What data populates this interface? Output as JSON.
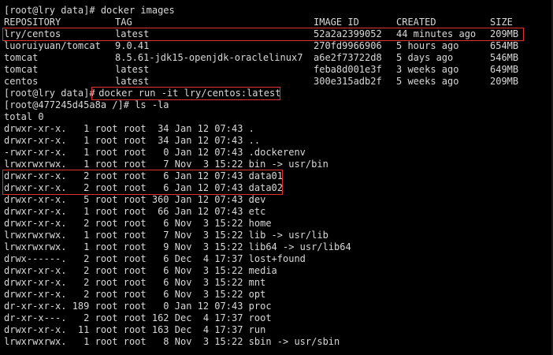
{
  "terminal": {
    "prompt_images": "[root@lry data]# docker images",
    "headers": {
      "repository": "REPOSITORY",
      "tag": "TAG",
      "image_id": "IMAGE ID",
      "created": "CREATED",
      "size": "SIZE"
    },
    "images": [
      {
        "repository": "lry/centos",
        "tag": "latest",
        "image_id": "52a2a2399052",
        "created": "44 minutes ago",
        "size": "209MB"
      },
      {
        "repository": "luoruiyuan/tomcat",
        "tag": "9.0.41",
        "image_id": "270fd9966906",
        "created": "5 hours ago",
        "size": "654MB"
      },
      {
        "repository": "tomcat",
        "tag": "8.5.61-jdk15-openjdk-oraclelinux7",
        "image_id": "a6e2f73722d8",
        "created": "5 days ago",
        "size": "546MB"
      },
      {
        "repository": "tomcat",
        "tag": "latest",
        "image_id": "feba8d001e3f",
        "created": "3 weeks ago",
        "size": "649MB"
      },
      {
        "repository": "centos",
        "tag": "latest",
        "image_id": "300e315adb2f",
        "created": "5 weeks ago",
        "size": "209MB"
      }
    ],
    "run_prompt": "[root@lry data]#",
    "run_command": " docker run -it lry/centos:latest",
    "ls_prompt": "[root@477245d45a8a /]# ls -la",
    "total": "total 0",
    "ls_lines": [
      "drwxr-xr-x.   1 root root  34 Jan 12 07:43 .",
      "drwxr-xr-x.   1 root root  34 Jan 12 07:43 ..",
      "-rwxr-xr-x.   1 root root   0 Jan 12 07:43 .dockerenv",
      "lrwxrwxrwx.   1 root root   7 Nov  3 15:22 bin -> usr/bin",
      "drwxr-xr-x.   2 root root   6 Jan 12 07:43 data01",
      "drwxr-xr-x.   2 root root   6 Jan 12 07:43 data02",
      "drwxr-xr-x.   5 root root 360 Jan 12 07:43 dev",
      "drwxr-xr-x.   1 root root  66 Jan 12 07:43 etc",
      "drwxr-xr-x.   2 root root   6 Nov  3 15:22 home",
      "lrwxrwxrwx.   1 root root   7 Nov  3 15:22 lib -> usr/lib",
      "lrwxrwxrwx.   1 root root   9 Nov  3 15:22 lib64 -> usr/lib64",
      "drwx------.   2 root root   6 Dec  4 17:37 lost+found",
      "drwxr-xr-x.   2 root root   6 Nov  3 15:22 media",
      "drwxr-xr-x.   2 root root   6 Nov  3 15:22 mnt",
      "drwxr-xr-x.   2 root root   6 Nov  3 15:22 opt",
      "dr-xr-xr-x. 189 root root   0 Jan 12 07:43 proc",
      "dr-xr-x---.   2 root root 162 Dec  4 17:37 root",
      "drwxr-xr-x.  11 root root 163 Dec  4 17:37 run",
      "lrwxrwxrwx.   1 root root   8 Nov  3 15:22 sbin -> usr/sbin"
    ],
    "highlight_color": "#e03030",
    "text_color": "#d8d8d8",
    "background_color": "#000000"
  }
}
